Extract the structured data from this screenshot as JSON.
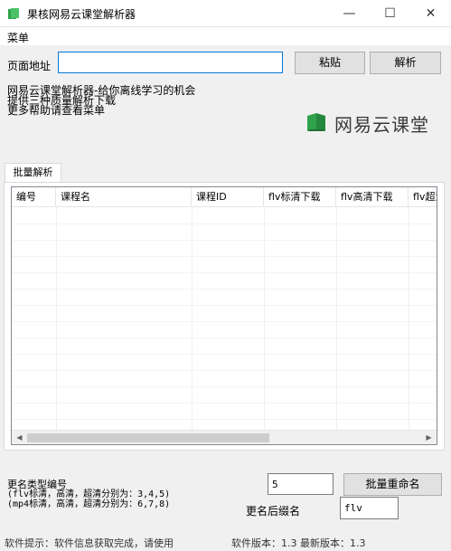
{
  "window": {
    "title": "果核网易云课堂解析器",
    "min_glyph": "—",
    "max_glyph": "☐",
    "close_glyph": "✕"
  },
  "menu": {
    "label": "菜单"
  },
  "url_row": {
    "label": "页面地址",
    "value": "",
    "paste_label": "粘贴",
    "parse_label": "解析"
  },
  "info": {
    "line1": "网易云课堂解析器-给你离线学习的机会",
    "line2": "提供三种质量解析下载",
    "line3": "更多帮助请查看菜单"
  },
  "logo": {
    "text": "网易云课堂",
    "icon": "netease-book-icon",
    "color": "#2fa34c"
  },
  "tabs": [
    {
      "label": "批量解析"
    }
  ],
  "table": {
    "columns": [
      "编号",
      "课程名",
      "课程ID",
      "flv标清下载",
      "flv高清下载",
      "flv超清下载"
    ],
    "rows": []
  },
  "rename": {
    "type_label": "更名类型编号",
    "flv_hint": "(flv标清，高清，超清分别为：3,4,5)",
    "mp4_hint": "(mp4标清，高清，超清分别为：6,7,8)",
    "type_value": "5",
    "button_label": "批量重命名",
    "suffix_label": "更名后缀名",
    "suffix_value": "flv"
  },
  "status": {
    "tip": "软件提示：软件信息获取完成，请使用",
    "version": "软件版本：1.3 最新版本：1.3"
  }
}
